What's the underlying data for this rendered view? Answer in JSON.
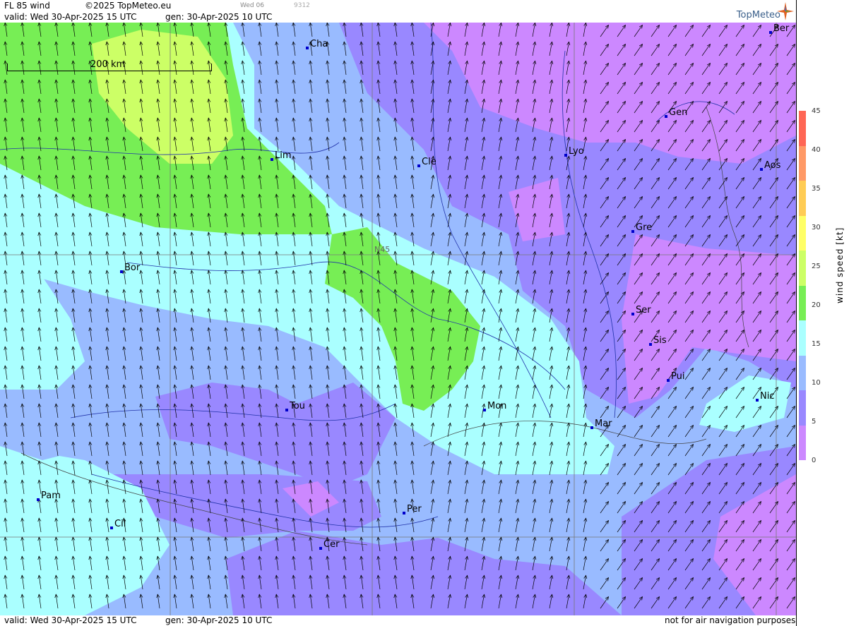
{
  "header": {
    "title": "FL 85 wind",
    "copyright": "©2025 TopMeteo.eu",
    "day_tag": "Wed 06",
    "code": "9312",
    "valid": "valid:  Wed  30-Apr-2025  15 UTC",
    "gen": "gen: 30-Apr-2025 10 UTC",
    "logo": "TopMeteo"
  },
  "scale": {
    "label": "200 km"
  },
  "grid_label": "N45",
  "cities": [
    {
      "name": "Cha"
    },
    {
      "name": "Lim"
    },
    {
      "name": "Cle"
    },
    {
      "name": "Lyo"
    },
    {
      "name": "Gen"
    },
    {
      "name": "Ber"
    },
    {
      "name": "Aos"
    },
    {
      "name": "Gre"
    },
    {
      "name": "Bor"
    },
    {
      "name": "Ser"
    },
    {
      "name": "Sis"
    },
    {
      "name": "Pui"
    },
    {
      "name": "Nic"
    },
    {
      "name": "Tou"
    },
    {
      "name": "Mon"
    },
    {
      "name": "Mar"
    },
    {
      "name": "Pam"
    },
    {
      "name": "Per"
    },
    {
      "name": "Cil"
    },
    {
      "name": "Cer"
    }
  ],
  "legend": {
    "title": "wind speed [kt]",
    "ticks": [
      "45",
      "40",
      "35",
      "30",
      "25",
      "20",
      "15",
      "10",
      "5",
      "0"
    ],
    "colors": [
      "#cc88ff",
      "#9988ff",
      "#99bbff",
      "#aaffff",
      "#77ee55",
      "#ccff66",
      "#ffff66",
      "#ffcc55",
      "#ff9966",
      "#ff6655"
    ]
  },
  "footer": {
    "valid": "valid:  Wed  30-Apr-2025  15 UTC",
    "gen": "gen: 30-Apr-2025 10 UTC",
    "disclaimer": "not for air navigation purposes"
  }
}
